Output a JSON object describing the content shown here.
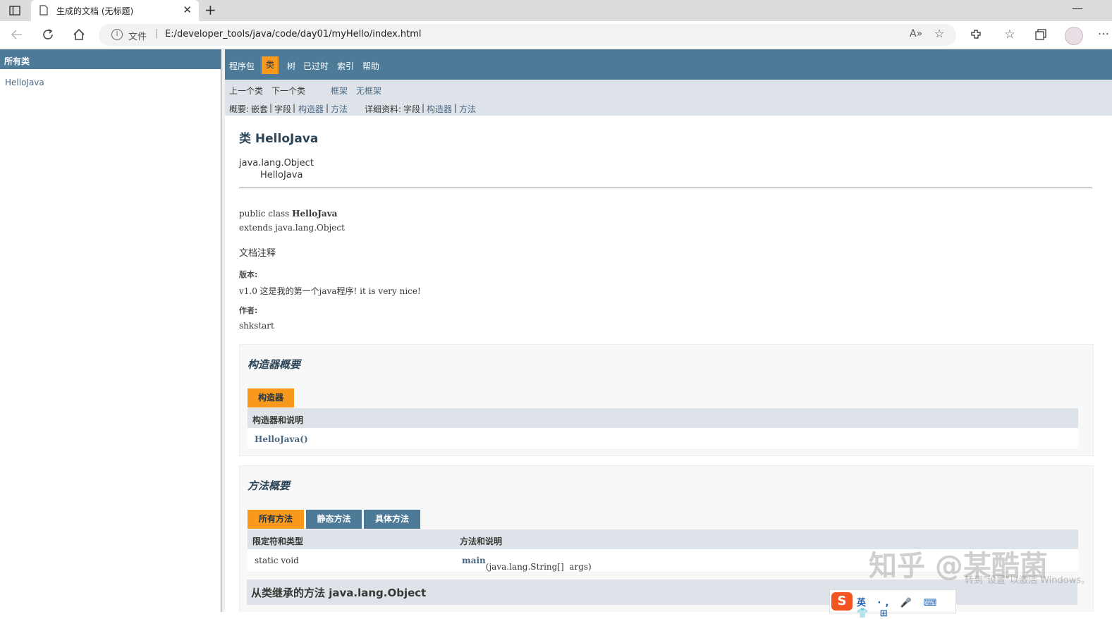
{
  "browser": {
    "tab_title": "生成的文档 (无标题)",
    "tab_close": "✕",
    "new_tab": "+",
    "minimize": "—",
    "address_prefix": "文件",
    "address_sep": "|",
    "url": "E:/developer_tools/java/code/day01/myHello/index.html",
    "more": "···"
  },
  "left_frame": {
    "header": "所有类",
    "classes": [
      "HelloJava"
    ]
  },
  "top_nav": {
    "items": [
      "程序包",
      "类",
      "树",
      "已过时",
      "索引",
      "帮助"
    ]
  },
  "sub_nav": {
    "prev_class": "上一个类",
    "next_class": "下一个类",
    "frames": "框架",
    "no_frames": "无框架",
    "summary_label": "概要:",
    "summary_nested": "嵌套",
    "summary_field": "字段",
    "summary_ctor": "构造器",
    "summary_method": "方法",
    "detail_label": "详细资料:",
    "detail_field": "字段",
    "detail_ctor": "构造器",
    "detail_method": "方法",
    "pipe": "|"
  },
  "class_doc": {
    "title": "类 HelloJava",
    "inheritance": [
      "java.lang.Object",
      "HelloJava"
    ],
    "decl_prefix": "public class ",
    "decl_name": "HelloJava",
    "decl_extends": "extends java.lang.Object",
    "comment": "文档注释",
    "version_label": "版本:",
    "version_value": "v1.0 这是我的第一个java程序! it is very nice!",
    "author_label": "作者:",
    "author_value": "shkstart"
  },
  "constructor_summary": {
    "title": "构造器概要",
    "tab": "构造器",
    "col_header": "构造器和说明",
    "rows": [
      "HelloJava()"
    ]
  },
  "method_summary": {
    "title": "方法概要",
    "tabs": [
      "所有方法",
      "静态方法",
      "具体方法"
    ],
    "col_modifier": "限定符和类型",
    "col_method": "方法和说明",
    "rows": [
      {
        "modifier": "static void",
        "name": "main",
        "params": "(java.lang.String[]  args)"
      }
    ],
    "inherited": "从类继承的方法 java.lang.Object"
  },
  "overlay": {
    "watermark": "知乎 @某酷菌",
    "activate": "转到\"设置\"以激活 Windows。",
    "ime_logo": "S",
    "ime_items": "英 ·, 🎤 ⌨ 👕 ⊞"
  },
  "colors": {
    "nav_bg": "#4d7a97",
    "active_tab": "#f8981d",
    "subnav_bg": "#dee3e9",
    "link": "#4a6782"
  }
}
